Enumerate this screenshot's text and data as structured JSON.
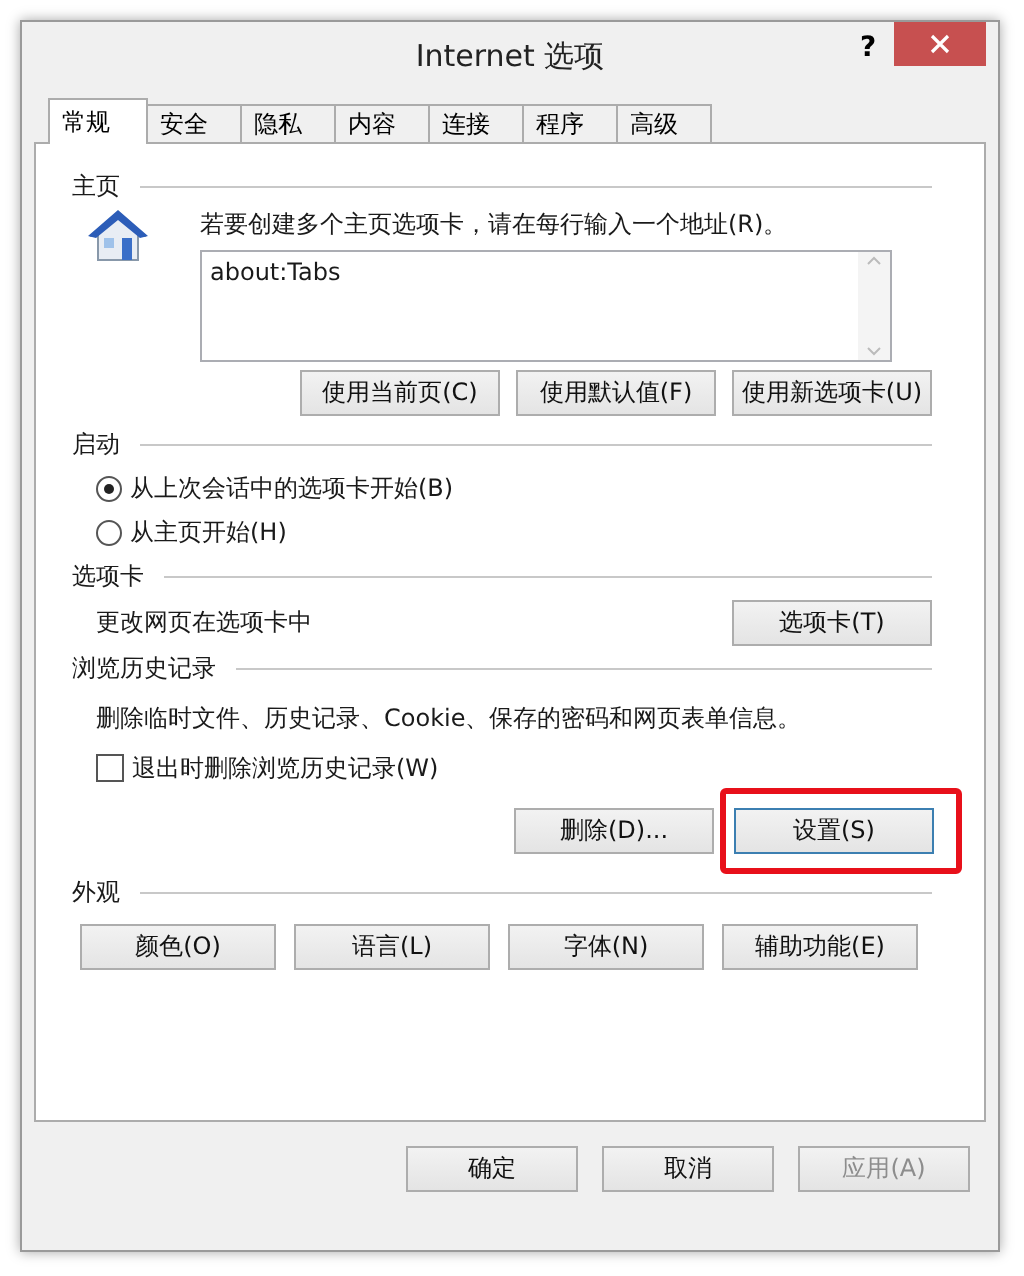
{
  "window": {
    "title": "Internet 选项",
    "help": "?"
  },
  "tabs": [
    {
      "label": "常规",
      "selected": true
    },
    {
      "label": "安全",
      "selected": false
    },
    {
      "label": "隐私",
      "selected": false
    },
    {
      "label": "内容",
      "selected": false
    },
    {
      "label": "连接",
      "selected": false
    },
    {
      "label": "程序",
      "selected": false
    },
    {
      "label": "高级",
      "selected": false
    }
  ],
  "home": {
    "heading": "主页",
    "description": "若要创建多个主页选项卡，请在每行输入一个地址(R)。",
    "value": "about:Tabs",
    "buttons": [
      "使用当前页(C)",
      "使用默认值(F)",
      "使用新选项卡(U)"
    ]
  },
  "startup": {
    "heading": "启动",
    "options": [
      {
        "label": "从上次会话中的选项卡开始(B)",
        "selected": true
      },
      {
        "label": "从主页开始(H)",
        "selected": false
      }
    ]
  },
  "tabs_section": {
    "heading": "选项卡",
    "description": "更改网页在选项卡中",
    "button": "选项卡(T)"
  },
  "history": {
    "heading": "浏览历史记录",
    "description": "删除临时文件、历史记录、Cookie、保存的密码和网页表单信息。",
    "checkbox": {
      "label": "退出时删除浏览历史记录(W)",
      "checked": false
    },
    "buttons": [
      {
        "label": "删除(D)...",
        "highlighted": false,
        "focused": false
      },
      {
        "label": "设置(S)",
        "highlighted": true,
        "focused": true
      }
    ]
  },
  "appearance": {
    "heading": "外观",
    "buttons": [
      "颜色(O)",
      "语言(L)",
      "字体(N)",
      "辅助功能(E)"
    ]
  },
  "footer": [
    {
      "label": "确定",
      "disabled": false
    },
    {
      "label": "取消",
      "disabled": false
    },
    {
      "label": "应用(A)",
      "disabled": true
    }
  ]
}
